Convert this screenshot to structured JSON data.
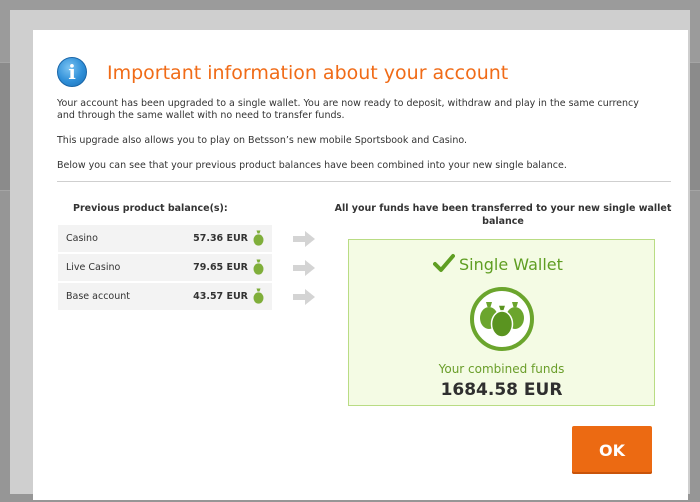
{
  "dialog": {
    "title": "Important information about your account",
    "paragraphs": [
      "Your account has been upgraded to a single wallet. You are now ready to deposit, withdraw and play in the same currency and through the same wallet with no need to transfer funds.",
      "This upgrade also allows you to play on Betsson’s new mobile Sportsbook and Casino.",
      "Below you can see that your previous product balances have been combined into your new single balance."
    ],
    "icons": {
      "info": "info-icon",
      "bag": "money-bag-icon",
      "arrow": "arrow-right-icon",
      "check": "checkmark-icon",
      "wallet": "wallet-bags-icon"
    },
    "colors": {
      "title": "#f06b17",
      "accent_green": "#6a9e2a",
      "ok_button": "#ec6a12"
    }
  },
  "balances": {
    "header": "Previous product balance(s):",
    "rows": [
      {
        "label": "Casino",
        "amount": "57.36 EUR"
      },
      {
        "label": "Live Casino",
        "amount": "79.65 EUR"
      },
      {
        "label": "Base account",
        "amount": "43.57 EUR"
      }
    ]
  },
  "wallet": {
    "header": "All your funds have been transferred to your new single wallet balance",
    "title": "Single Wallet",
    "combined_label": "Your combined funds",
    "combined_amount": "1684.58 EUR"
  },
  "actions": {
    "ok_label": "OK"
  }
}
